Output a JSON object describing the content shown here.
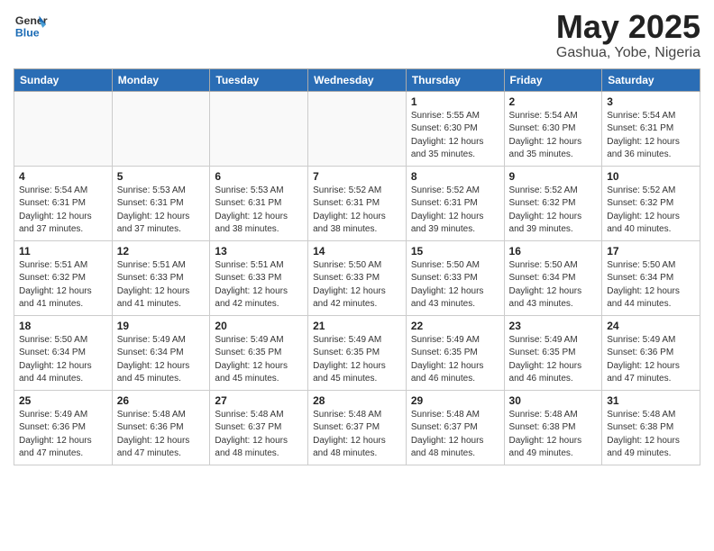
{
  "header": {
    "logo_general": "General",
    "logo_blue": "Blue",
    "month_year": "May 2025",
    "location": "Gashua, Yobe, Nigeria"
  },
  "days_of_week": [
    "Sunday",
    "Monday",
    "Tuesday",
    "Wednesday",
    "Thursday",
    "Friday",
    "Saturday"
  ],
  "weeks": [
    [
      {
        "day": "",
        "empty": true
      },
      {
        "day": "",
        "empty": true
      },
      {
        "day": "",
        "empty": true
      },
      {
        "day": "",
        "empty": true
      },
      {
        "day": "1",
        "info": "Sunrise: 5:55 AM\nSunset: 6:30 PM\nDaylight: 12 hours\nand 35 minutes."
      },
      {
        "day": "2",
        "info": "Sunrise: 5:54 AM\nSunset: 6:30 PM\nDaylight: 12 hours\nand 35 minutes."
      },
      {
        "day": "3",
        "info": "Sunrise: 5:54 AM\nSunset: 6:31 PM\nDaylight: 12 hours\nand 36 minutes."
      }
    ],
    [
      {
        "day": "4",
        "info": "Sunrise: 5:54 AM\nSunset: 6:31 PM\nDaylight: 12 hours\nand 37 minutes."
      },
      {
        "day": "5",
        "info": "Sunrise: 5:53 AM\nSunset: 6:31 PM\nDaylight: 12 hours\nand 37 minutes."
      },
      {
        "day": "6",
        "info": "Sunrise: 5:53 AM\nSunset: 6:31 PM\nDaylight: 12 hours\nand 38 minutes."
      },
      {
        "day": "7",
        "info": "Sunrise: 5:52 AM\nSunset: 6:31 PM\nDaylight: 12 hours\nand 38 minutes."
      },
      {
        "day": "8",
        "info": "Sunrise: 5:52 AM\nSunset: 6:31 PM\nDaylight: 12 hours\nand 39 minutes."
      },
      {
        "day": "9",
        "info": "Sunrise: 5:52 AM\nSunset: 6:32 PM\nDaylight: 12 hours\nand 39 minutes."
      },
      {
        "day": "10",
        "info": "Sunrise: 5:52 AM\nSunset: 6:32 PM\nDaylight: 12 hours\nand 40 minutes."
      }
    ],
    [
      {
        "day": "11",
        "info": "Sunrise: 5:51 AM\nSunset: 6:32 PM\nDaylight: 12 hours\nand 41 minutes."
      },
      {
        "day": "12",
        "info": "Sunrise: 5:51 AM\nSunset: 6:33 PM\nDaylight: 12 hours\nand 41 minutes."
      },
      {
        "day": "13",
        "info": "Sunrise: 5:51 AM\nSunset: 6:33 PM\nDaylight: 12 hours\nand 42 minutes."
      },
      {
        "day": "14",
        "info": "Sunrise: 5:50 AM\nSunset: 6:33 PM\nDaylight: 12 hours\nand 42 minutes."
      },
      {
        "day": "15",
        "info": "Sunrise: 5:50 AM\nSunset: 6:33 PM\nDaylight: 12 hours\nand 43 minutes."
      },
      {
        "day": "16",
        "info": "Sunrise: 5:50 AM\nSunset: 6:34 PM\nDaylight: 12 hours\nand 43 minutes."
      },
      {
        "day": "17",
        "info": "Sunrise: 5:50 AM\nSunset: 6:34 PM\nDaylight: 12 hours\nand 44 minutes."
      }
    ],
    [
      {
        "day": "18",
        "info": "Sunrise: 5:50 AM\nSunset: 6:34 PM\nDaylight: 12 hours\nand 44 minutes."
      },
      {
        "day": "19",
        "info": "Sunrise: 5:49 AM\nSunset: 6:34 PM\nDaylight: 12 hours\nand 45 minutes."
      },
      {
        "day": "20",
        "info": "Sunrise: 5:49 AM\nSunset: 6:35 PM\nDaylight: 12 hours\nand 45 minutes."
      },
      {
        "day": "21",
        "info": "Sunrise: 5:49 AM\nSunset: 6:35 PM\nDaylight: 12 hours\nand 45 minutes."
      },
      {
        "day": "22",
        "info": "Sunrise: 5:49 AM\nSunset: 6:35 PM\nDaylight: 12 hours\nand 46 minutes."
      },
      {
        "day": "23",
        "info": "Sunrise: 5:49 AM\nSunset: 6:35 PM\nDaylight: 12 hours\nand 46 minutes."
      },
      {
        "day": "24",
        "info": "Sunrise: 5:49 AM\nSunset: 6:36 PM\nDaylight: 12 hours\nand 47 minutes."
      }
    ],
    [
      {
        "day": "25",
        "info": "Sunrise: 5:49 AM\nSunset: 6:36 PM\nDaylight: 12 hours\nand 47 minutes."
      },
      {
        "day": "26",
        "info": "Sunrise: 5:48 AM\nSunset: 6:36 PM\nDaylight: 12 hours\nand 47 minutes."
      },
      {
        "day": "27",
        "info": "Sunrise: 5:48 AM\nSunset: 6:37 PM\nDaylight: 12 hours\nand 48 minutes."
      },
      {
        "day": "28",
        "info": "Sunrise: 5:48 AM\nSunset: 6:37 PM\nDaylight: 12 hours\nand 48 minutes."
      },
      {
        "day": "29",
        "info": "Sunrise: 5:48 AM\nSunset: 6:37 PM\nDaylight: 12 hours\nand 48 minutes."
      },
      {
        "day": "30",
        "info": "Sunrise: 5:48 AM\nSunset: 6:38 PM\nDaylight: 12 hours\nand 49 minutes."
      },
      {
        "day": "31",
        "info": "Sunrise: 5:48 AM\nSunset: 6:38 PM\nDaylight: 12 hours\nand 49 minutes."
      }
    ]
  ]
}
